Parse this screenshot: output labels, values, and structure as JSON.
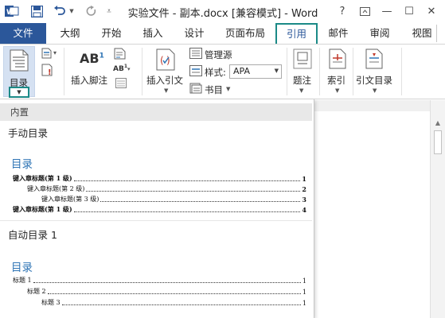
{
  "window": {
    "title": "实验文件 - 副本.docx [兼容模式] - Word",
    "help_glyph": "?",
    "ribbon_display_glyph": "⧉",
    "minimize_glyph": "—",
    "maximize_glyph": "☐",
    "close_glyph": "✕"
  },
  "tabs": [
    {
      "label": "文件"
    },
    {
      "label": "大纲"
    },
    {
      "label": "开始"
    },
    {
      "label": "插入"
    },
    {
      "label": "设计"
    },
    {
      "label": "页面布局"
    },
    {
      "label": "引用"
    },
    {
      "label": "邮件"
    },
    {
      "label": "审阅"
    },
    {
      "label": "视图"
    }
  ],
  "ribbon": {
    "toc_label": "目录",
    "insert_footnote_label": "插入脚注",
    "footnote_ab": "AB",
    "footnote_sup": "1",
    "insert_citation_label": "插入引文",
    "manage_sources_label": "管理源",
    "style_label": "样式:",
    "style_value": "APA",
    "bibliography_label": "书目",
    "caption_label": "题注",
    "index_label": "索引",
    "toa_label": "引文目录"
  },
  "toc_gallery": {
    "builtin_header": "内置",
    "manual_title": "手动目录",
    "manual_heading": "目录",
    "manual_entries": [
      {
        "text": "键入章标题(第 1 级)",
        "page": "1"
      },
      {
        "text": "键入章标题(第 2 级)",
        "page": "2"
      },
      {
        "text": "键入章标题(第 3 级)",
        "page": "3"
      },
      {
        "text": "键入章标题(第 1 级)",
        "page": "4"
      }
    ],
    "auto1_title": "自动目录 1",
    "auto1_heading": "目录",
    "auto1_entries": [
      {
        "text": "标题 1",
        "page": "1"
      },
      {
        "text": "标题 2",
        "page": "1"
      },
      {
        "text": "标题 3",
        "page": "1"
      }
    ]
  },
  "colors": {
    "file_tab": "#2b579a",
    "highlight_box": "#1b8a87",
    "toc_heading": "#2e74b5"
  }
}
